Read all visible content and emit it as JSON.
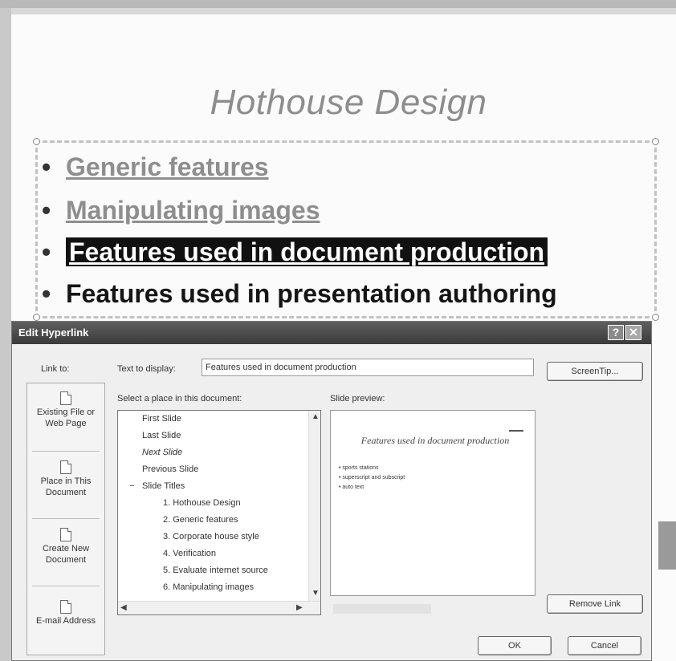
{
  "slide": {
    "title": "Hothouse Design",
    "bullet_char": "•",
    "bullets": [
      {
        "text": "Generic features"
      },
      {
        "text": "Manipulating images"
      },
      {
        "text": "Features used in document production"
      },
      {
        "text": "Features used in presentation authoring"
      }
    ]
  },
  "dialog": {
    "title": "Edit Hyperlink",
    "help_label": "?",
    "close_label": "✕",
    "link_to_label": "Link to:",
    "text_to_display_label": "Text to display:",
    "text_to_display_value": "Features used in document production",
    "screentip_button": "ScreenTip...",
    "select_place_label": "Select a place in this document:",
    "slide_preview_label": "Slide preview:",
    "nav_items": [
      {
        "label": "Existing File or Web Page",
        "icon": "web-page-icon"
      },
      {
        "label": "Place in This Document",
        "icon": "document-place-icon"
      },
      {
        "label": "Create New Document",
        "icon": "new-document-icon"
      },
      {
        "label": "E-mail Address",
        "icon": "email-icon"
      }
    ],
    "list_items": [
      {
        "label": "First Slide"
      },
      {
        "label": "Last Slide"
      },
      {
        "label": "Next Slide"
      },
      {
        "label": "Previous Slide"
      },
      {
        "label": "Slide Titles",
        "toggle": "−"
      },
      {
        "label": "1. Hothouse Design"
      },
      {
        "label": "2. Generic features"
      },
      {
        "label": "3. Corporate house style"
      },
      {
        "label": "4. Verification"
      },
      {
        "label": "5. Evaluate internet source"
      },
      {
        "label": "6. Manipulating images"
      }
    ],
    "preview": {
      "title": "Features used in document production",
      "bullets": [
        "• sports stations",
        "• superscript and subscript",
        "• auto text"
      ]
    },
    "remove_link_button": "Remove Link",
    "ok_button": "OK",
    "cancel_button": "Cancel"
  }
}
